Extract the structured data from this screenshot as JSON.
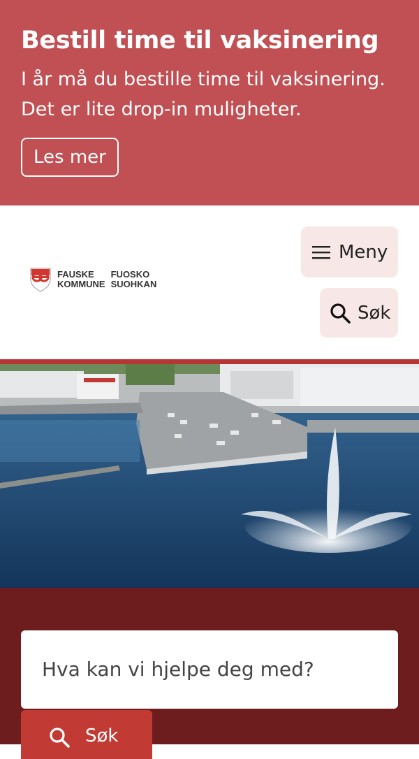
{
  "banner": {
    "title": "Bestill time til vaksinering",
    "text_line1": "I år må du bestille time til vaksinering.",
    "text_line2": "Det er lite drop-in muligheter.",
    "read_more_label": "Les mer"
  },
  "header": {
    "logo": {
      "line1_left": "FAUSKE",
      "line1_right": "FUOSKO",
      "line2_left": "KOMMUNE",
      "line2_right": "SUOHKAN"
    },
    "menu_label": "Meny",
    "search_label": "Søk"
  },
  "hero": {
    "icon": "harbor-fountain-photo"
  },
  "search": {
    "placeholder": "Hva kan vi hjelpe deg med?",
    "submit_label": "Søk"
  },
  "colors": {
    "banner_bg": "#c05054",
    "header_button_bg": "#f7e8e7",
    "hero_border": "#b83535",
    "search_area_bg": "#6d1d1d",
    "search_button_bg": "#c23a34"
  }
}
